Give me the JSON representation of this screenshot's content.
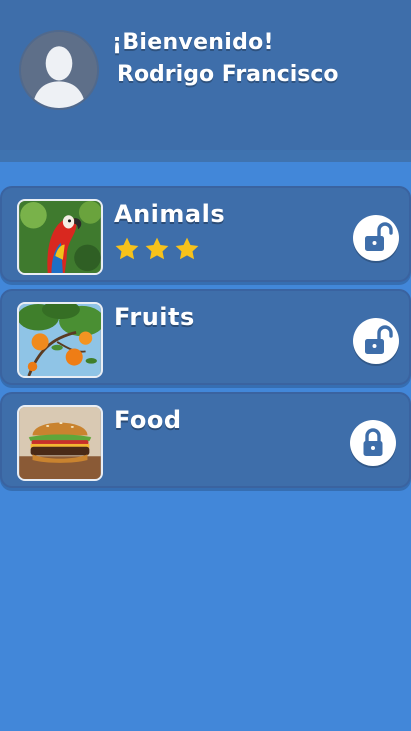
{
  "header": {
    "welcome": "¡Bienvenido!",
    "user_name": "Rodrigo Francisco"
  },
  "categories": [
    {
      "title": "Animals",
      "stars": 3,
      "locked": false,
      "image": "parrot-image"
    },
    {
      "title": "Fruits",
      "stars": 0,
      "locked": false,
      "image": "oranges-image"
    },
    {
      "title": "Food",
      "stars": 0,
      "locked": true,
      "image": "burger-image"
    }
  ],
  "colors": {
    "background": "#4287d9",
    "header": "#3e6eaa",
    "card": "#3e6eaa",
    "star": "#f7c21b",
    "lock_icon": "#3e6eaa"
  }
}
